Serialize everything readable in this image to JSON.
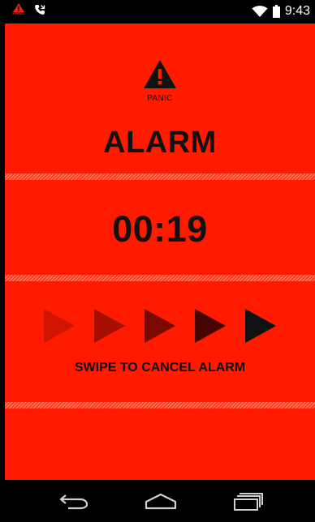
{
  "status_bar": {
    "panic_label": "PANIC",
    "time": "9:43",
    "icons": [
      "panic-warning-icon",
      "missed-call-icon",
      "wifi-icon",
      "battery-icon"
    ]
  },
  "alarm_screen": {
    "panic_caption": "PANIC",
    "title": "ALARM",
    "timer": "00:19",
    "swipe_instruction": "SWIPE TO CANCEL ALARM",
    "swipe_arrow_colors": [
      "#cf1400",
      "#a60f00",
      "#7a0900",
      "#470500",
      "#111111"
    ]
  },
  "nav_bar": {
    "buttons": [
      "back-button",
      "home-button",
      "recents-button"
    ]
  },
  "colors": {
    "background": "#ff1b00",
    "text": "#111111",
    "bars": "#000000"
  }
}
